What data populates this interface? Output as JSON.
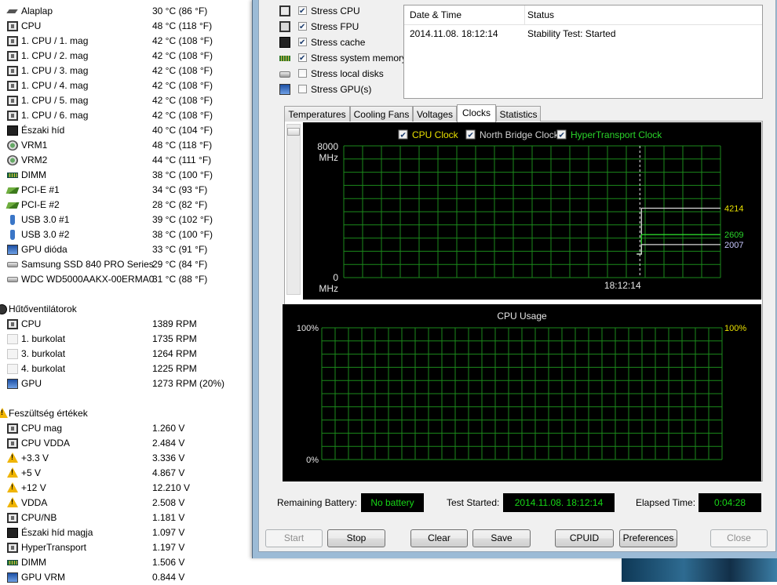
{
  "sensors": {
    "temps": [
      {
        "icon": "motherboard-temp-icon",
        "label": "Alaplap",
        "value": "30 °C  (86 °F)"
      },
      {
        "icon": "cpu-icon",
        "label": "CPU",
        "value": "48 °C  (118 °F)"
      },
      {
        "icon": "cpu-icon",
        "label": "1. CPU / 1. mag",
        "value": "42 °C  (108 °F)"
      },
      {
        "icon": "cpu-icon",
        "label": "1. CPU / 2. mag",
        "value": "42 °C  (108 °F)"
      },
      {
        "icon": "cpu-icon",
        "label": "1. CPU / 3. mag",
        "value": "42 °C  (108 °F)"
      },
      {
        "icon": "cpu-icon",
        "label": "1. CPU / 4. mag",
        "value": "42 °C  (108 °F)"
      },
      {
        "icon": "cpu-icon",
        "label": "1. CPU / 5. mag",
        "value": "42 °C  (108 °F)"
      },
      {
        "icon": "cpu-icon",
        "label": "1. CPU / 6. mag",
        "value": "42 °C  (108 °F)"
      },
      {
        "icon": "northbridge-icon",
        "label": "Északi híd",
        "value": "40 °C  (104 °F)"
      },
      {
        "icon": "vrm-icon",
        "label": "VRM1",
        "value": "48 °C  (118 °F)"
      },
      {
        "icon": "vrm-icon",
        "label": "VRM2",
        "value": "44 °C  (111 °F)"
      },
      {
        "icon": "dimm-icon",
        "label": "DIMM",
        "value": "38 °C  (100 °F)"
      },
      {
        "icon": "pcie-icon",
        "label": "PCI-E #1",
        "value": "34 °C  (93 °F)"
      },
      {
        "icon": "pcie-icon",
        "label": "PCI-E #2",
        "value": "28 °C  (82 °F)"
      },
      {
        "icon": "usb-icon",
        "label": "USB 3.0 #1",
        "value": "39 °C  (102 °F)"
      },
      {
        "icon": "usb-icon",
        "label": "USB 3.0 #2",
        "value": "38 °C  (100 °F)"
      },
      {
        "icon": "gpu-icon",
        "label": "GPU dióda",
        "value": "33 °C  (91 °F)"
      },
      {
        "icon": "disk-icon",
        "label": "Samsung SSD 840 PRO Series",
        "value": "29 °C  (84 °F)"
      },
      {
        "icon": "disk-icon",
        "label": "WDC WD5000AAKX-00ERMA0",
        "value": "31 °C  (88 °F)"
      }
    ],
    "fans_title": "Hűtőventilátorok",
    "fans": [
      {
        "icon": "cpu-icon",
        "label": "CPU",
        "value": "1389 RPM"
      },
      {
        "icon": "case-fan-icon",
        "label": "1. burkolat",
        "value": "1735 RPM"
      },
      {
        "icon": "case-fan-icon",
        "label": "3. burkolat",
        "value": "1264 RPM"
      },
      {
        "icon": "case-fan-icon",
        "label": "4. burkolat",
        "value": "1225 RPM"
      },
      {
        "icon": "gpu-icon",
        "label": "GPU",
        "value": "1273 RPM  (20%)"
      }
    ],
    "volt_title": "Feszültség értékek",
    "volts": [
      {
        "icon": "cpu-icon",
        "label": "CPU mag",
        "value": "1.260 V"
      },
      {
        "icon": "cpu-icon",
        "label": "CPU VDDA",
        "value": "2.484 V"
      },
      {
        "icon": "warning-icon",
        "label": "+3.3 V",
        "value": "3.336 V"
      },
      {
        "icon": "warning-icon",
        "label": "+5 V",
        "value": "4.867 V"
      },
      {
        "icon": "warning-icon",
        "label": "+12 V",
        "value": "12.210 V"
      },
      {
        "icon": "warning-icon",
        "label": "VDDA",
        "value": "2.508 V"
      },
      {
        "icon": "cpu-icon",
        "label": "CPU/NB",
        "value": "1.181 V"
      },
      {
        "icon": "northbridge-icon",
        "label": "Északi híd magja",
        "value": "1.097 V"
      },
      {
        "icon": "cpu-icon",
        "label": "HyperTransport",
        "value": "1.197 V"
      },
      {
        "icon": "dimm-icon",
        "label": "DIMM",
        "value": "1.506 V"
      },
      {
        "icon": "gpu-icon",
        "label": "GPU VRM",
        "value": "0.844 V"
      }
    ]
  },
  "stress": [
    {
      "label": "Stress CPU",
      "checked": true,
      "icon": "cpu-stress-icon"
    },
    {
      "label": "Stress FPU",
      "checked": true,
      "icon": "fpu-stress-icon"
    },
    {
      "label": "Stress cache",
      "checked": true,
      "icon": "cache-stress-icon"
    },
    {
      "label": "Stress system memory",
      "checked": true,
      "icon": "memory-stress-icon"
    },
    {
      "label": "Stress local disks",
      "checked": false,
      "icon": "disk-stress-icon"
    },
    {
      "label": "Stress GPU(s)",
      "checked": false,
      "icon": "gpu-stress-icon"
    }
  ],
  "log": {
    "col_date": "Date & Time",
    "col_status": "Status",
    "rows": [
      {
        "date": "2014.11.08. 18:12:14",
        "status": "Stability Test: Started"
      }
    ]
  },
  "tabs": [
    "Temperatures",
    "Cooling Fans",
    "Voltages",
    "Clocks",
    "Statistics"
  ],
  "active_tab": "Clocks",
  "chart_data": [
    {
      "type": "line",
      "legend": [
        "CPU Clock",
        "North Bridge Clock",
        "HyperTransport Clock"
      ],
      "legend_colors": [
        "#e8e000",
        "#d0d0d0",
        "#2ad42a"
      ],
      "y_top_label": "8000",
      "y_bottom_label": "0",
      "y_unit": "MHz",
      "x_label": "18:12:14",
      "ylim": [
        0,
        8000
      ],
      "series": [
        {
          "name": "CPU Clock",
          "color": "#d8d8d8",
          "value": 4214,
          "value_label": "4214",
          "label_color": "#e8e000"
        },
        {
          "name": "HyperTransport Clock",
          "color": "#2ad42a",
          "value": 2609,
          "value_label": "2609",
          "label_color": "#2ad42a"
        },
        {
          "name": "North Bridge Clock",
          "color": "#d8d8d8",
          "value": 2007,
          "value_label": "2007",
          "label_color": "#c8c8ff"
        }
      ],
      "grid": true
    },
    {
      "type": "line",
      "title": "CPU Usage",
      "y_top_label": "100%",
      "y_bottom_label": "0%",
      "current_label": "100%",
      "ylim": [
        0,
        100
      ],
      "grid": true
    }
  ],
  "status": {
    "battery_label": "Remaining Battery:",
    "battery_value": "No battery",
    "started_label": "Test Started:",
    "started_value": "2014.11.08. 18:12:14",
    "elapsed_label": "Elapsed Time:",
    "elapsed_value": "0:04:28"
  },
  "buttons": {
    "start": "Start",
    "stop": "Stop",
    "clear": "Clear",
    "save": "Save",
    "cpuid": "CPUID",
    "preferences": "Preferences",
    "close": "Close"
  }
}
